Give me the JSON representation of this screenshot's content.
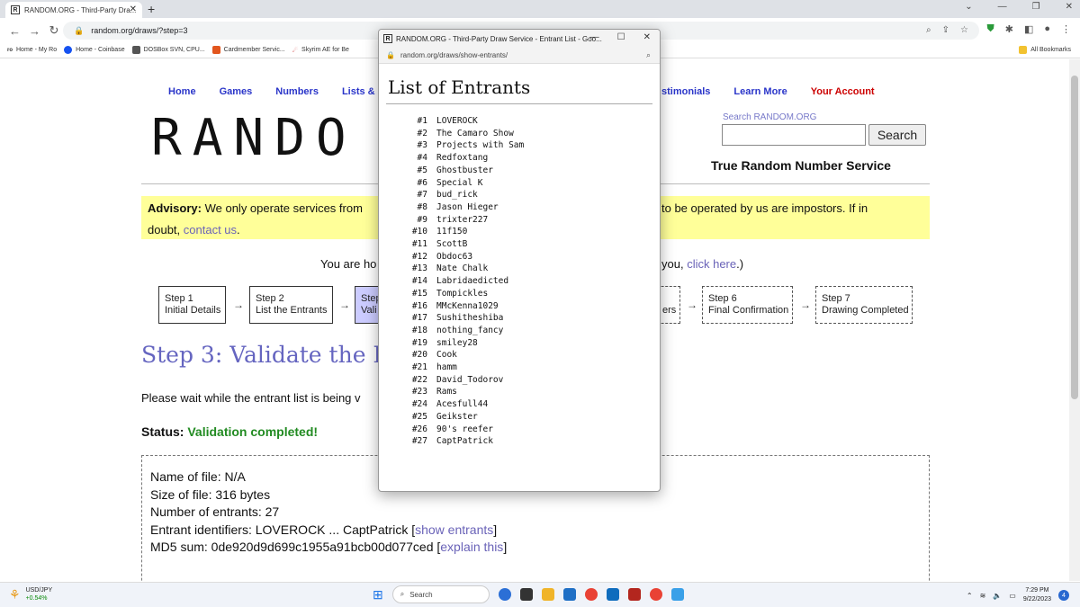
{
  "browser": {
    "tab_title": "RANDOM.ORG - Third-Party Dra...",
    "url": "random.org/draws/?step=3",
    "bookmarks": [
      "Home - My Ro",
      "Home - Coinbase",
      "DOSBox SVN, CPU...",
      "Cardmember Servic...",
      "Skyrim AE for Be"
    ],
    "all_bookmarks": "All Bookmarks"
  },
  "nav": {
    "left": [
      "Home",
      "Games",
      "Numbers",
      "Lists &"
    ],
    "right": [
      "stimonials",
      "Learn More"
    ],
    "account": "Your Account"
  },
  "logo": "RANDO",
  "search": {
    "label": "Search RANDOM.ORG",
    "button": "Search"
  },
  "tagline": "True Random Number Service",
  "advisory": {
    "bold": "Advisory:",
    "text": "We only operate services from",
    "tail": "to be operated by us are impostors. If in",
    "line2_prefix": "doubt,",
    "link": "contact us",
    "line2_suffix": "."
  },
  "here": {
    "left": "You are ho",
    "right_prefix": "you,",
    "link": "click here",
    "right_suffix": ".)"
  },
  "steps": [
    {
      "title": "Step 1",
      "label": "Initial Details"
    },
    {
      "title": "Step 2",
      "label": "List the Entrants"
    },
    {
      "title": "Step",
      "label": "Vali"
    },
    {
      "title": "",
      "label": "ers"
    },
    {
      "title": "Step 6",
      "label": "Final Confirmation"
    },
    {
      "title": "Step 7",
      "label": "Drawing Completed"
    }
  ],
  "step_arrow": "→",
  "heading": "Step 3: Validate the Ent",
  "wait_text": "Please wait while the entrant list is being v",
  "status": {
    "label": "Status:",
    "value": "Validation completed!"
  },
  "info": {
    "file_name": "Name of file: N/A",
    "file_size": "Size of file: 316 bytes",
    "entrants": "Number of entrants: 27",
    "identifiers_prefix": "Entrant identifiers: LOVEROCK ... CaptPatrick [",
    "show_link": "show entrants",
    "identifiers_suffix": "]",
    "md5_prefix": "MD5 sum: 0de920d9d699c1955a91bcb00d077ced [",
    "explain_link": "explain this",
    "md5_suffix": "]"
  },
  "popup": {
    "title": "RANDOM.ORG - Third-Party Draw Service - Entrant List - Goo...",
    "url": "random.org/draws/show-entrants/",
    "heading": "List of Entrants",
    "entrants": [
      {
        "num": "#1",
        "name": "LOVEROCK"
      },
      {
        "num": "#2",
        "name": "The Camaro Show"
      },
      {
        "num": "#3",
        "name": "Projects with Sam"
      },
      {
        "num": "#4",
        "name": "Redfoxtang"
      },
      {
        "num": "#5",
        "name": "Ghostbuster"
      },
      {
        "num": "#6",
        "name": "Special K"
      },
      {
        "num": "#7",
        "name": "bud_rick"
      },
      {
        "num": "#8",
        "name": "Jason Hieger"
      },
      {
        "num": "#9",
        "name": "trixter227"
      },
      {
        "num": "#10",
        "name": "11f150"
      },
      {
        "num": "#11",
        "name": "ScottB"
      },
      {
        "num": "#12",
        "name": "Obdoc63"
      },
      {
        "num": "#13",
        "name": "Nate Chalk"
      },
      {
        "num": "#14",
        "name": "Labridaedicted"
      },
      {
        "num": "#15",
        "name": "Tompickles"
      },
      {
        "num": "#16",
        "name": "MMcKenna1029"
      },
      {
        "num": "#17",
        "name": "Sushitheshiba"
      },
      {
        "num": "#18",
        "name": "nothing_fancy"
      },
      {
        "num": "#19",
        "name": "smiley28"
      },
      {
        "num": "#20",
        "name": "Cook"
      },
      {
        "num": "#21",
        "name": "hamm"
      },
      {
        "num": "#22",
        "name": "David_Todorov"
      },
      {
        "num": "#23",
        "name": "Rams"
      },
      {
        "num": "#24",
        "name": "Acesfull44"
      },
      {
        "num": "#25",
        "name": "Geikster"
      },
      {
        "num": "#26",
        "name": "90's reefer"
      },
      {
        "num": "#27",
        "name": "CaptPatrick"
      }
    ]
  },
  "taskbar": {
    "ticker": "USD/JPY",
    "change": "+0.54%",
    "search": "Search",
    "time": "7:29 PM",
    "date": "9/22/2023",
    "notifications": "4"
  }
}
